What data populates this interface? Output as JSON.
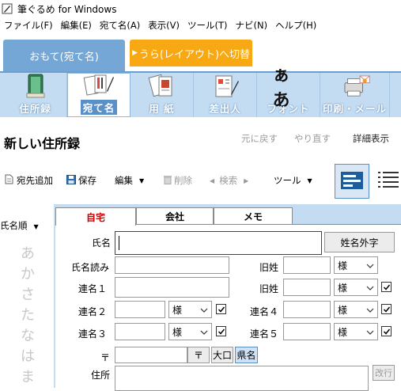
{
  "window": {
    "title": "筆ぐるめ for Windows"
  },
  "menu": [
    "ファイル(F)",
    "編集(E)",
    "宛て名(A)",
    "表示(V)",
    "ツール(T)",
    "ナビ(N)",
    "ヘルプ(H)"
  ],
  "tabs": {
    "front": "おもて(宛て名)",
    "back": "うら(レイアウト)へ切替"
  },
  "toolbar": {
    "address_book": "住所録",
    "addressee": "宛て名",
    "paper": "用 紙",
    "sender": "差出人",
    "font": "フォント",
    "print_mail": "印刷・メール",
    "font_icon_text": "ぁあ"
  },
  "header": {
    "title": "新しい住所録",
    "undo": "元に戻す",
    "redo": "やり直す",
    "detail": "詳細表示"
  },
  "actions": {
    "add": "宛先追加",
    "save": "保存",
    "edit": "編集",
    "delete": "削除",
    "search": "検索",
    "tool": "ツール"
  },
  "sidebar": {
    "sort": "氏名順",
    "kana": [
      "あ",
      "か",
      "さ",
      "た",
      "な",
      "は",
      "ま"
    ]
  },
  "subtabs": {
    "home": "自宅",
    "company": "会社",
    "memo": "メモ"
  },
  "form": {
    "name_label": "氏名",
    "name_ext_button": "姓名外字",
    "reading_label": "氏名読み",
    "old_surname_label": "旧姓",
    "honorific": "様",
    "joint1": "連名１",
    "joint2": "連名２",
    "joint3": "連名３",
    "joint4": "連名４",
    "joint5": "連名５",
    "postal_mark": "〒",
    "postal_button": "〒",
    "okuchi_button": "大口",
    "kenmei_button": "県名",
    "address_label": "住所",
    "linebreak_button": "改行"
  },
  "colors": {
    "toolbar_bg": "#c4dcf2",
    "front_tab": "#74a6d6",
    "back_tab": "#f7a812",
    "subtab_active_text": "#cc0000"
  }
}
